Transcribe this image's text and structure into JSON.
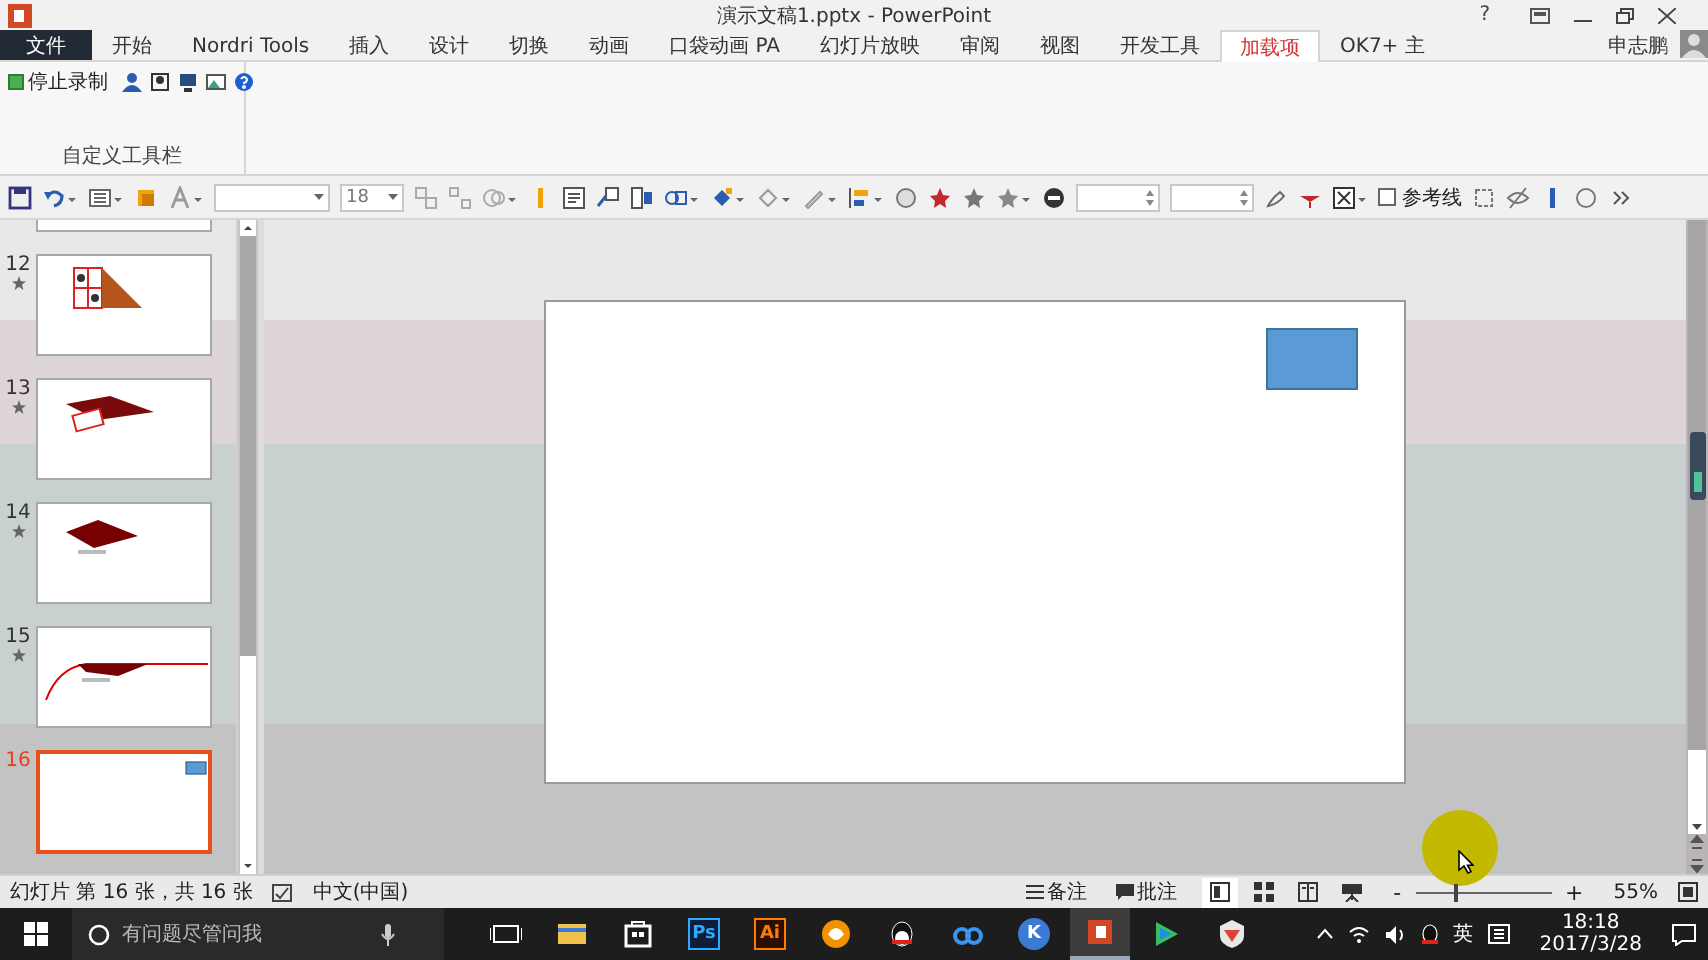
{
  "window": {
    "title": "演示文稿1.pptx - PowerPoint",
    "help": "?",
    "user": "申志鹏"
  },
  "tabs": [
    {
      "label": "文件",
      "kind": "file",
      "selected": false
    },
    {
      "label": "开始",
      "kind": "tab",
      "selected": false
    },
    {
      "label": "Nordri Tools",
      "kind": "tab",
      "selected": false
    },
    {
      "label": "插入",
      "kind": "tab",
      "selected": false
    },
    {
      "label": "设计",
      "kind": "tab",
      "selected": false
    },
    {
      "label": "切换",
      "kind": "tab",
      "selected": false
    },
    {
      "label": "动画",
      "kind": "tab",
      "selected": false
    },
    {
      "label": "口袋动画 PA",
      "kind": "tab",
      "selected": false
    },
    {
      "label": "幻灯片放映",
      "kind": "tab",
      "selected": false
    },
    {
      "label": "审阅",
      "kind": "tab",
      "selected": false
    },
    {
      "label": "视图",
      "kind": "tab",
      "selected": false
    },
    {
      "label": "开发工具",
      "kind": "tab",
      "selected": false
    },
    {
      "label": "加载项",
      "kind": "tab",
      "selected": true
    },
    {
      "label": "OK7+ 主",
      "kind": "tab",
      "selected": false
    }
  ],
  "ribbon": {
    "stop_recording": "停止录制",
    "group_label": "自定义工具栏"
  },
  "toolbar": {
    "font_size": "18",
    "guides_checkbox": {
      "label": "参考线",
      "checked": false
    }
  },
  "slides": [
    {
      "animated": false,
      "selected": false
    },
    {
      "number": "12",
      "animated": true,
      "selected": false
    },
    {
      "number": "13",
      "animated": true,
      "selected": false
    },
    {
      "number": "14",
      "animated": true,
      "selected": false
    },
    {
      "number": "15",
      "animated": true,
      "selected": false
    },
    {
      "number": "16",
      "animated": false,
      "selected": true
    }
  ],
  "status_bar": {
    "slide_info": "幻灯片 第 16 张，共 16 张",
    "language": "中文(中国)",
    "notes": "备注",
    "comments": "批注",
    "views": [
      {
        "selected": true
      },
      {
        "selected": false
      },
      {
        "selected": false
      },
      {
        "selected": false
      }
    ],
    "zoom": {
      "minus": "-",
      "plus": "+",
      "level": 0.28,
      "reading": "55%"
    }
  },
  "taskbar": {
    "search": {
      "placeholder": "有问题尽管问我"
    },
    "apps": [
      {
        "kind": "taskview",
        "active": false
      },
      {
        "kind": "folder",
        "active": false
      },
      {
        "kind": "store",
        "active": false
      },
      {
        "kind": "ps",
        "label": "Ps",
        "active": false
      },
      {
        "kind": "ai",
        "label": "Ai",
        "active": false
      },
      {
        "kind": "browser",
        "active": false
      },
      {
        "kind": "penguin",
        "active": false
      },
      {
        "kind": "cloud",
        "active": false
      },
      {
        "kind": "k",
        "label": "K",
        "active": false
      },
      {
        "kind": "ppt",
        "active": true
      },
      {
        "kind": "play",
        "active": false
      },
      {
        "kind": "shield",
        "active": false
      }
    ],
    "ime": "英",
    "time": "18:18",
    "date": "2017/3/28"
  }
}
